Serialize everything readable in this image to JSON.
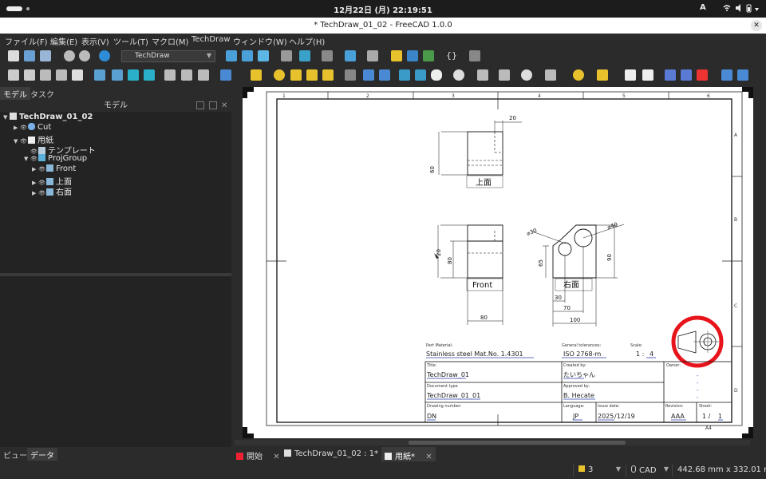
{
  "system": {
    "clock": "12月22日 (月)  22:19:51",
    "ime": "A"
  },
  "window": {
    "title": "* TechDraw_01_02 - FreeCAD 1.0.0"
  },
  "menu": [
    "ファイル(F)",
    "編集(E)",
    "表示(V)",
    "ツール(T)",
    "マクロ(M)",
    "TechDraw",
    "ウィンドウ(W)",
    "ヘルプ(H)"
  ],
  "toolbar": {
    "workbench": "TechDraw",
    "macro_braces": "{}"
  },
  "left_panel": {
    "tabs": [
      "モデル",
      "タスク"
    ],
    "header": "モデル",
    "tree": [
      {
        "label": "TechDraw_01_02",
        "bold": true
      },
      {
        "label": "Cut"
      },
      {
        "label": "用紙"
      },
      {
        "label": "テンプレート"
      },
      {
        "label": "ProjGroup"
      },
      {
        "label": "Front"
      },
      {
        "label": "上面"
      },
      {
        "label": "右面"
      }
    ],
    "bottom_tabs": [
      "ビュー",
      "データ"
    ]
  },
  "drawing": {
    "col_numbers": [
      "1",
      "2",
      "3",
      "4",
      "5",
      "6"
    ],
    "row_letters": [
      "A",
      "B",
      "C",
      "D"
    ],
    "view_labels": {
      "top": "上面",
      "front": "Front",
      "right": "右面"
    },
    "dims": {
      "top_width": "20",
      "top_height": "60",
      "front_height_outer": "20",
      "front_height": "80",
      "front_width": "80",
      "right_d30": "⌀30",
      "right_d40": "⌀40",
      "right_h65": "65",
      "right_h90": "90",
      "right_w30": "30",
      "right_w70": "70",
      "right_w100": "100"
    },
    "part_material_label": "Part Material:",
    "part_material": "Stainless steel Mat.No. 1.4301",
    "general_tol_label": "General tolerances:",
    "general_tol": "ISO 2768-m",
    "scale_label": "Scale:",
    "scale_prefix": "1 :",
    "scale": "4",
    "owner_label": "Owner:",
    "owner_dashes": [
      "-",
      "-",
      "-",
      "-"
    ],
    "title_label": "Title:",
    "title": "TechDraw_01",
    "created_label": "Created by:",
    "created_by": "たいちゃん",
    "doctype_label": "Document type",
    "doctype": "TechDraw_01_01",
    "approved_label": "Approved by:",
    "approved_by": "B. Hecate",
    "drawnum_label": "Drawing number:",
    "drawnum": "DN",
    "lang_label": "Language:",
    "language": "JP",
    "issue_label": "Issue date:",
    "issue_date_year": "2025",
    "issue_date_rest": "/12/19",
    "rev_label": "Revision:",
    "revision": "AAA",
    "sheet_label": "Sheet:",
    "sheet_prefix": "1 /",
    "sheet": "1",
    "paper": "A4"
  },
  "doc_tabs": [
    "開始",
    "TechDraw_01_02 : 1*",
    "用紙*"
  ],
  "status": {
    "layer": "3",
    "nav": "CAD",
    "dims": "442.68 mm x 332.01 mm"
  },
  "annotation_color": "#e8141c"
}
